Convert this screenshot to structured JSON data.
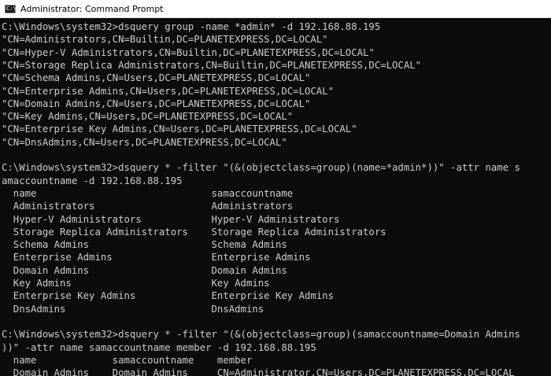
{
  "window": {
    "title": "Administrator: Command Prompt",
    "icon": "cmd-icon",
    "icon_text": "C:\\"
  },
  "colors": {
    "background": "#0c0c0c",
    "text": "#cccccc",
    "titlebar": "#ffffff"
  },
  "console": {
    "lines": [
      "C:\\Windows\\system32>dsquery group -name *admin* -d 192.168.88.195",
      "\"CN=Administrators,CN=Builtin,DC=PLANETEXPRESS,DC=LOCAL\"",
      "\"CN=Hyper-V Administrators,CN=Builtin,DC=PLANETEXPRESS,DC=LOCAL\"",
      "\"CN=Storage Replica Administrators,CN=Builtin,DC=PLANETEXPRESS,DC=LOCAL\"",
      "\"CN=Schema Admins,CN=Users,DC=PLANETEXPRESS,DC=LOCAL\"",
      "\"CN=Enterprise Admins,CN=Users,DC=PLANETEXPRESS,DC=LOCAL\"",
      "\"CN=Domain Admins,CN=Users,DC=PLANETEXPRESS,DC=LOCAL\"",
      "\"CN=Key Admins,CN=Users,DC=PLANETEXPRESS,DC=LOCAL\"",
      "\"CN=Enterprise Key Admins,CN=Users,DC=PLANETEXPRESS,DC=LOCAL\"",
      "\"CN=DnsAdmins,CN=Users,DC=PLANETEXPRESS,DC=LOCAL\"",
      "",
      "C:\\Windows\\system32>dsquery * -filter \"(&(objectclass=group)(name=*admin*))\" -attr name s",
      "amaccountname -d 192.168.88.195",
      "  name                              samaccountname",
      "  Administrators                    Administrators",
      "  Hyper-V Administrators            Hyper-V Administrators",
      "  Storage Replica Administrators    Storage Replica Administrators",
      "  Schema Admins                     Schema Admins",
      "  Enterprise Admins                 Enterprise Admins",
      "  Domain Admins                     Domain Admins",
      "  Key Admins                        Key Admins",
      "  Enterprise Key Admins             Enterprise Key Admins",
      "  DnsAdmins                         DnsAdmins",
      "",
      "C:\\Windows\\system32>dsquery * -filter \"(&(objectclass=group)(samaccountname=Domain Admins",
      "))\" -attr name samaccountname member -d 192.168.88.195",
      "  name             samaccountname    member",
      "  Domain Admins    Domain Admins     CN=Administrator,CN=Users,DC=PLANETEXPRESS,DC=LOCAL"
    ]
  }
}
